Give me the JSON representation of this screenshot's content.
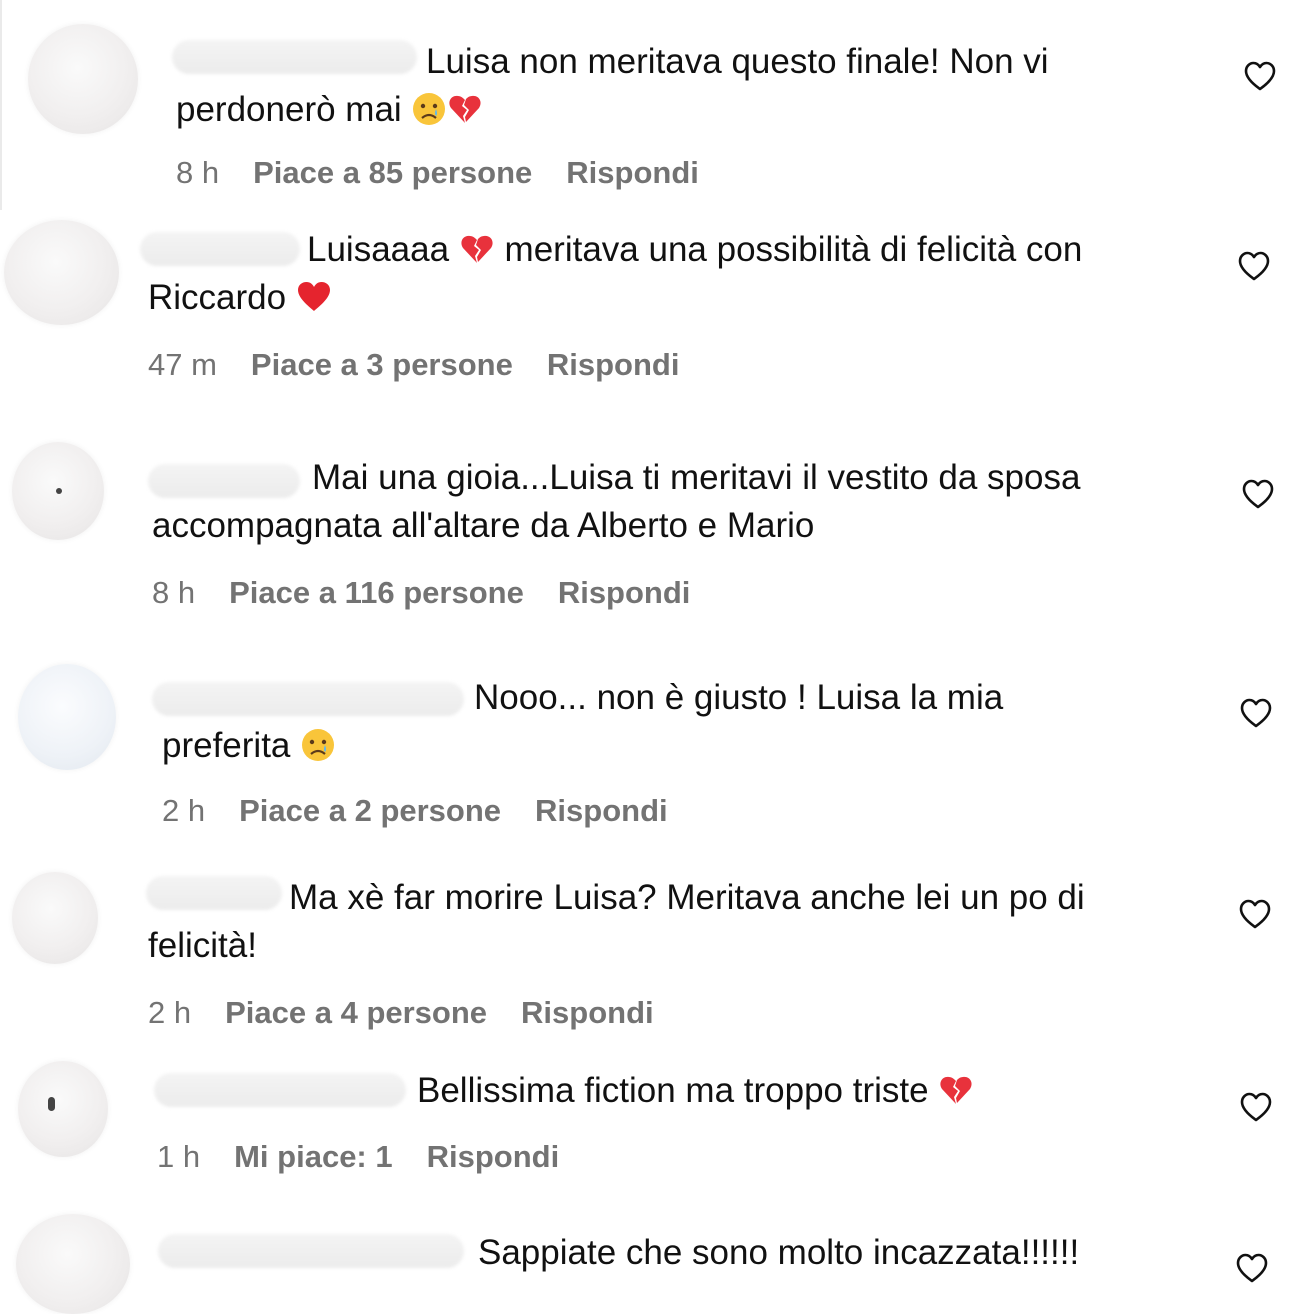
{
  "comments": [
    {
      "line1": "Luisa non meritava questo finale! Non vi",
      "line2": "perdonerò mai",
      "line2_emojis": [
        "crying-face",
        "broken-heart"
      ],
      "time": "8 h",
      "likes": "Piace a 85 persone",
      "reply": "Rispondi"
    },
    {
      "line1a": "Luisaaaa",
      "line1_emoji": "broken-heart",
      "line1b": "meritava una possibilità di felicità con",
      "line2": "Riccardo",
      "line2_emojis": [
        "red-heart"
      ],
      "time": "47 m",
      "likes": "Piace a 3 persone",
      "reply": "Rispondi"
    },
    {
      "line1": "Mai una gioia...Luisa ti meritavi il vestito da sposa",
      "line2": "accompagnata all'altare da Alberto e Mario",
      "time": "8 h",
      "likes": "Piace a 116 persone",
      "reply": "Rispondi"
    },
    {
      "line1": "Nooo... non è giusto ! Luisa la mia",
      "line2": "preferita",
      "line2_emojis": [
        "crying-face"
      ],
      "time": "2 h",
      "likes": "Piace a 2 persone",
      "reply": "Rispondi"
    },
    {
      "line1": "Ma xè far morire Luisa? Meritava anche lei un po di",
      "line2": "felicità!",
      "time": "2 h",
      "likes": "Piace a 4 persone",
      "reply": "Rispondi"
    },
    {
      "line1": "Bellissima fiction ma troppo triste",
      "line1_emojis": [
        "broken-heart"
      ],
      "time": "1 h",
      "likes": "Mi piace: 1",
      "reply": "Rispondi"
    },
    {
      "line1": "Sappiate che sono molto incazzata!!!!!!"
    }
  ],
  "icons": {
    "like": "heart-outline-icon"
  },
  "colors": {
    "text": "#111111",
    "meta": "#737373",
    "broken_heart": "#e8323c",
    "red_heart": "#e5242e",
    "emoji_face": "#f9c53a"
  }
}
